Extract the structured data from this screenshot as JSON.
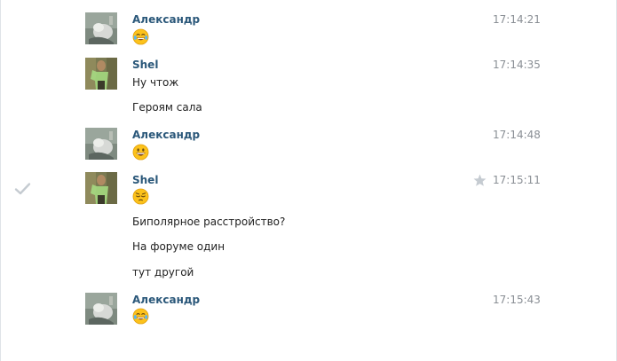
{
  "messages": [
    {
      "author": "Александр",
      "time": "17:14:21",
      "emoji": "face-with-tears-of-joy-emoji",
      "lines": []
    },
    {
      "author": "Shel",
      "time": "17:14:35",
      "lines": [
        "Ну чтож",
        "Героям сала"
      ]
    },
    {
      "author": "Александр",
      "time": "17:14:48",
      "emoji": "grinning-face-emoji",
      "lines": []
    },
    {
      "author": "Shel",
      "time": "17:15:11",
      "emoji": "pensive-face-emoji",
      "lines": [
        "Биполярное расстройство?",
        "На форуме один",
        "тут другой"
      ]
    },
    {
      "author": "Александр",
      "time": "17:15:43",
      "emoji": "face-with-tears-of-joy-emoji",
      "lines": []
    }
  ],
  "icons": {
    "check": "check-icon",
    "star": "star-icon"
  },
  "colors": {
    "author_link": "#2b587a",
    "timestamp": "#8a8f95",
    "icon_gray": "#c5cbd1",
    "emoji_yellow": "#fcc21b"
  }
}
